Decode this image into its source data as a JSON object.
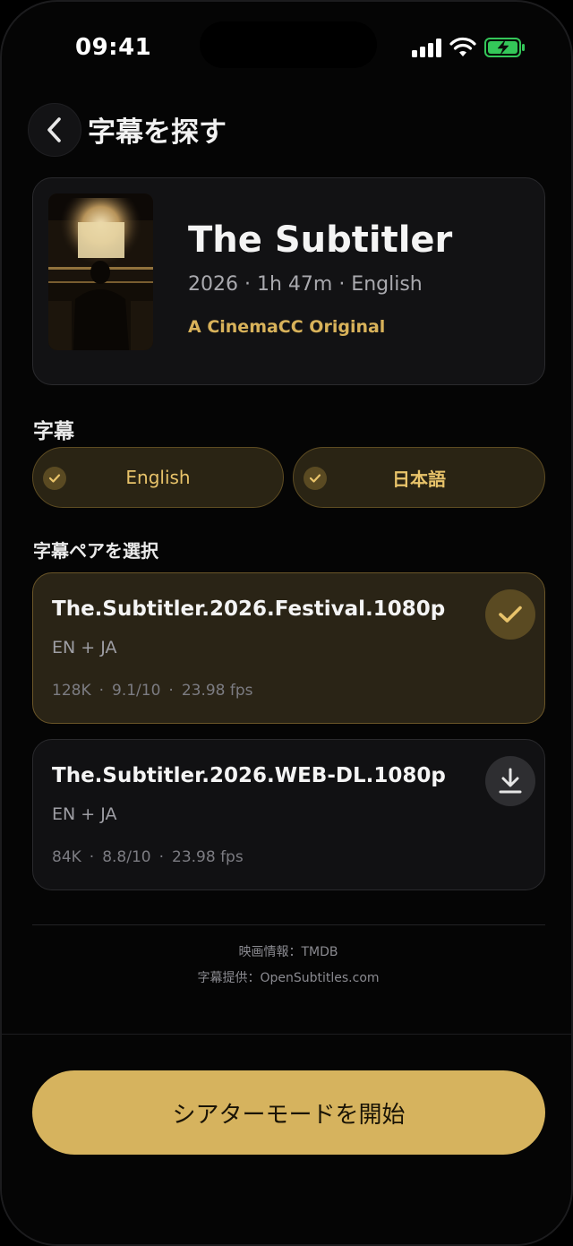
{
  "status_bar": {
    "time": "09:41"
  },
  "header": {
    "title": "字幕を探す",
    "back_icon": "chevron-left-icon"
  },
  "movie": {
    "title": "The Subtitler",
    "meta": "2026 · 1h 47m · English",
    "tag": "A CinemaCC Original"
  },
  "subtitles_section": {
    "label": "字幕",
    "languages": [
      {
        "label": "English",
        "selected": true
      },
      {
        "label": "日本語",
        "selected": true
      }
    ]
  },
  "pair_section": {
    "label": "字幕ペアを選択",
    "items": [
      {
        "name": "The.Subtitler.2026.Festival.1080p",
        "langs": "EN + JA",
        "downloads": "128K",
        "rating": "9.1/10",
        "fps": "23.98 fps",
        "selected": true,
        "action_icon": "check-icon"
      },
      {
        "name": "The.Subtitler.2026.WEB-DL.1080p",
        "langs": "EN + JA",
        "downloads": "84K",
        "rating": "8.8/10",
        "fps": "23.98 fps",
        "selected": false,
        "action_icon": "download-icon"
      }
    ]
  },
  "credits": {
    "movie_info": "映画情報：TMDB",
    "subtitle_provider": "字幕提供：OpenSubtitles.com"
  },
  "primary_action": {
    "label": "シアターモードを開始"
  },
  "colors": {
    "accent": "#d6b35e",
    "accent_text": "#e8c36a",
    "background": "#050505",
    "card": "#121214"
  }
}
